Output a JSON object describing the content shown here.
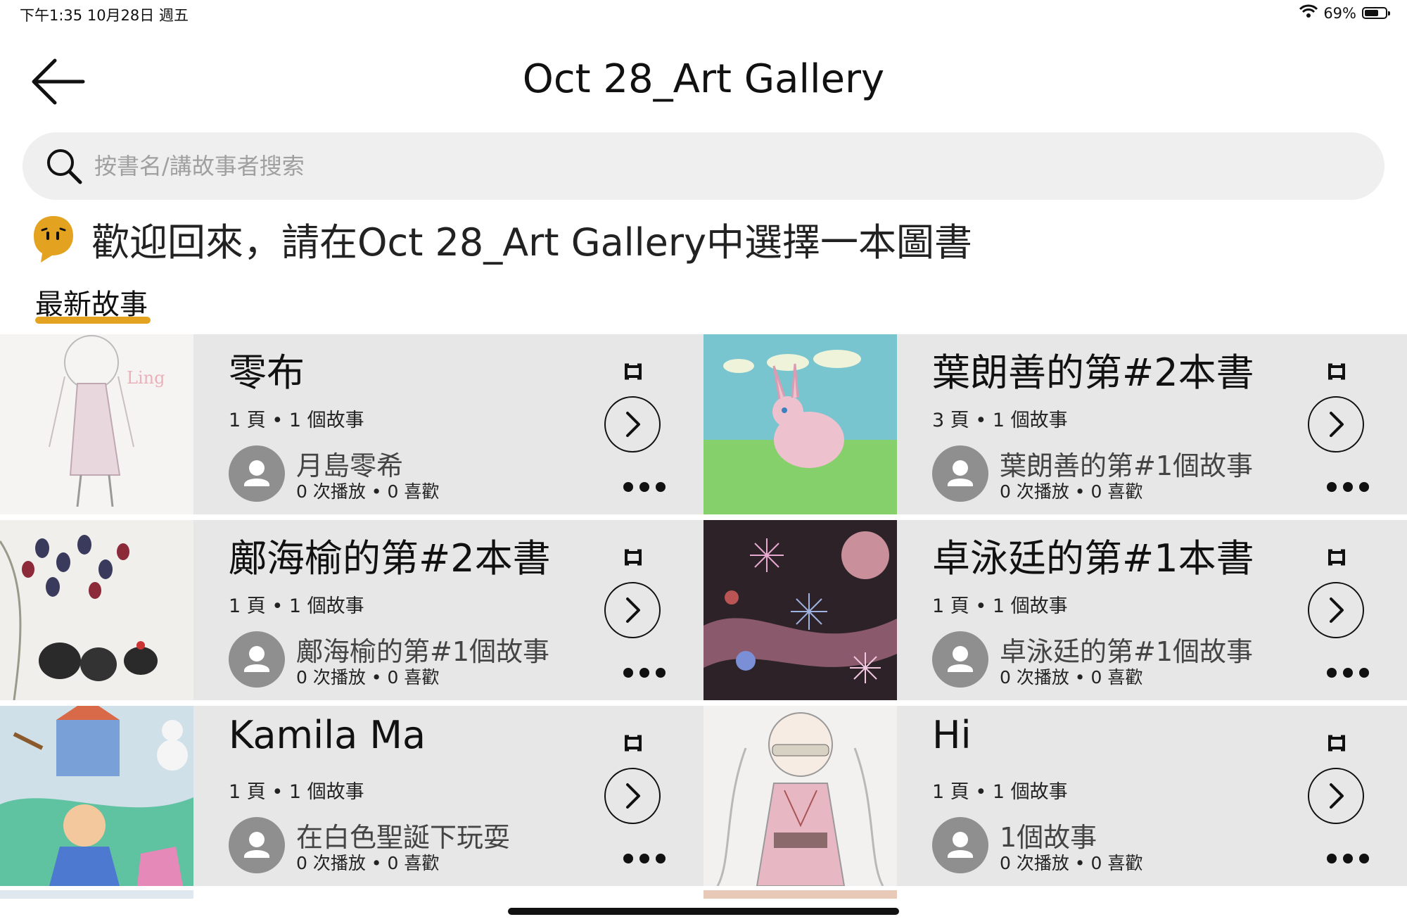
{
  "status_bar": {
    "time_date": "下午1:35   10月28日 週五",
    "battery": "69%",
    "battery_level": 0.69
  },
  "header": {
    "title": "Oct 28_Art Gallery"
  },
  "search": {
    "placeholder": "按書名/講故事者搜索"
  },
  "welcome": {
    "text": "歡迎回來，請在Oct 28_Art Gallery中選擇一本圖書"
  },
  "tabs": [
    {
      "label": "最新故事",
      "active": true
    }
  ],
  "colors": {
    "accent": "#e3a321",
    "card_bg": "#e7e7e7",
    "avatar": "#8f8f8f"
  },
  "books": [
    {
      "title": "零布",
      "meta": "1 頁 • 1 個故事",
      "author": "月島零希",
      "stats": "0 次播放 • 0 喜歡"
    },
    {
      "title": "葉朗善的第#2本書",
      "meta": "3 頁 • 1 個故事",
      "author": "葉朗善的第#1個故事",
      "stats": "0 次播放 • 0 喜歡"
    },
    {
      "title": "鄺海榆的第#2本書",
      "meta": "1 頁 • 1 個故事",
      "author": "鄺海榆的第#1個故事",
      "stats": "0 次播放 • 0 喜歡"
    },
    {
      "title": "卓泳廷的第#1本書",
      "meta": "1 頁 • 1 個故事",
      "author": "卓泳廷的第#1個故事",
      "stats": "0 次播放 • 0 喜歡"
    },
    {
      "title": "Kamila Ma",
      "meta": "1 頁 • 1 個故事",
      "author": "在白色聖誕下玩耍",
      "stats": "0 次播放 • 0 喜歡"
    },
    {
      "title": "Hi",
      "meta": "1 頁 • 1 個故事",
      "author": "1個故事",
      "stats": "0 次播放 • 0 喜歡"
    }
  ]
}
